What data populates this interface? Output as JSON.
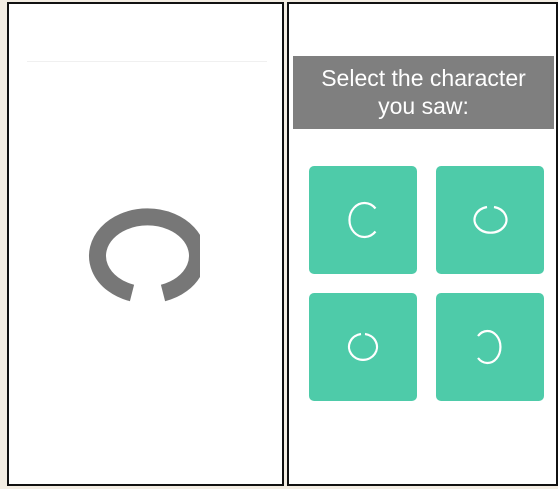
{
  "left_panel": {
    "stimulus_icon": "c-ring-gap-bottom-icon",
    "stimulus_color": "#777777"
  },
  "right_panel": {
    "prompt": "Select the character you saw:",
    "prompt_bg": "#7f7f7f",
    "options": [
      {
        "icon": "c-ring-gap-right-icon"
      },
      {
        "icon": "c-ring-gap-top-icon"
      },
      {
        "icon": "c-ring-gap-top-small-icon"
      },
      {
        "icon": "c-ring-gap-left-icon"
      }
    ],
    "option_color": "#4ecba9",
    "glyph_color": "#ffffff"
  }
}
